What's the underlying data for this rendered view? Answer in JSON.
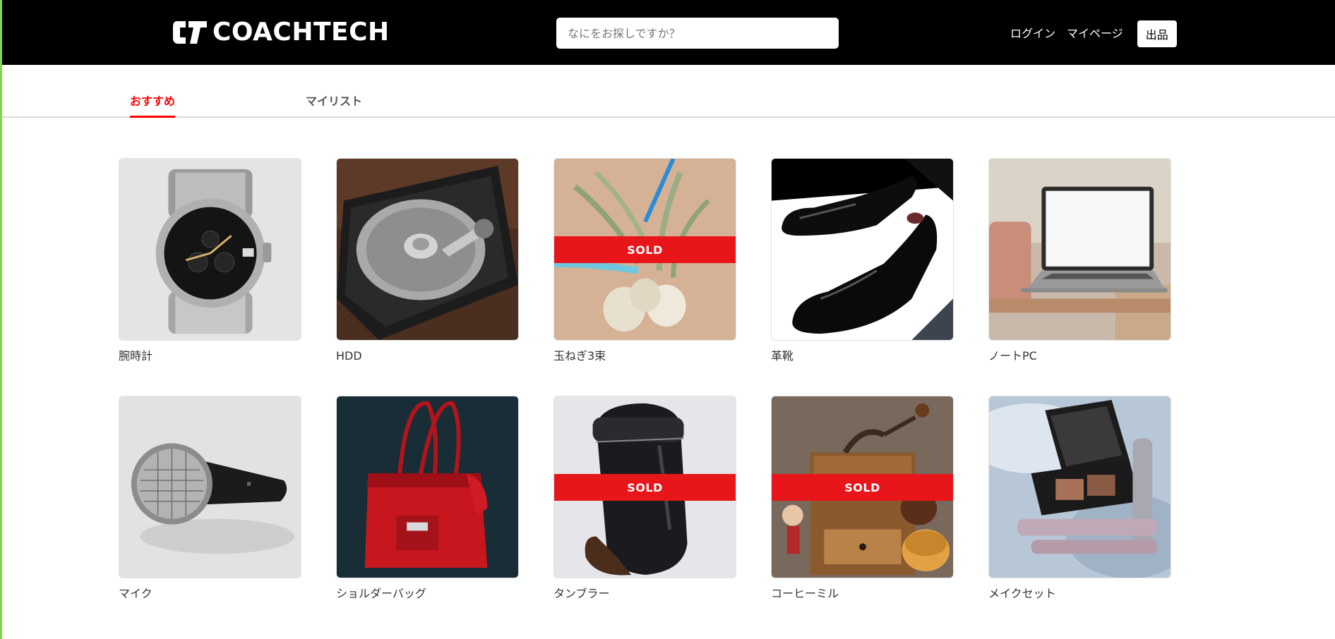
{
  "header": {
    "logo_text": "COACHTECH",
    "search_placeholder": "なにをお探しですか？",
    "nav": {
      "login": "ログイン",
      "mypage": "マイページ",
      "sell": "出品"
    }
  },
  "tabs": {
    "recommend": "おすすめ",
    "mylist": "マイリスト",
    "active_color": "#ff0000"
  },
  "sold_label": "SOLD",
  "items": [
    {
      "name": "腕時計",
      "sold": false,
      "icon": "wristwatch-image"
    },
    {
      "name": "HDD",
      "sold": false,
      "icon": "hard-disk-image"
    },
    {
      "name": "玉ねぎ3束",
      "sold": true,
      "icon": "onions-image"
    },
    {
      "name": "革靴",
      "sold": false,
      "icon": "leather-shoes-image"
    },
    {
      "name": "ノートPC",
      "sold": false,
      "icon": "laptop-image"
    },
    {
      "name": "マイク",
      "sold": false,
      "icon": "microphone-image"
    },
    {
      "name": "ショルダーバッグ",
      "sold": false,
      "icon": "shoulder-bag-image"
    },
    {
      "name": "タンブラー",
      "sold": true,
      "icon": "tumbler-image"
    },
    {
      "name": "コーヒーミル",
      "sold": true,
      "icon": "coffee-mill-image"
    },
    {
      "name": "メイクセット",
      "sold": false,
      "icon": "makeup-set-image"
    }
  ],
  "colors": {
    "header_bg": "#000000",
    "accent": "#ff0000",
    "sold_bg": "#e8151b"
  }
}
